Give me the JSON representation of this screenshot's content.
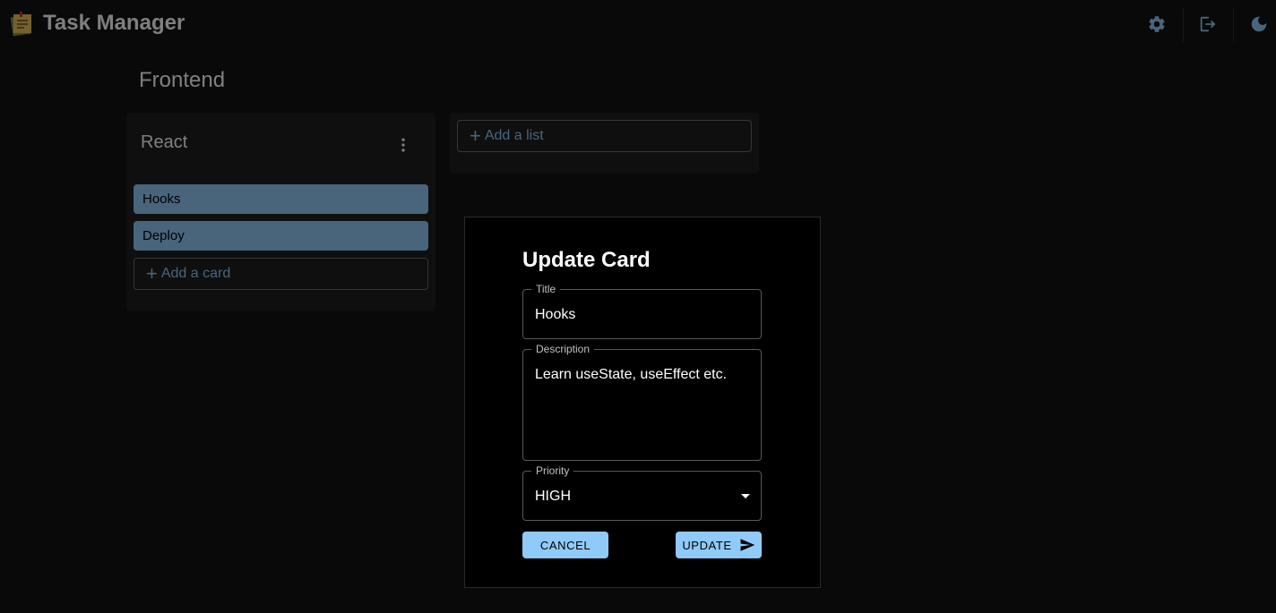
{
  "appbar": {
    "title": "Task Manager",
    "icons": [
      "settings-gear-icon",
      "logout-icon",
      "dark-mode-moon-icon"
    ]
  },
  "board": {
    "title": "Frontend",
    "lists": [
      {
        "title": "React",
        "cards": [
          {
            "title": "Hooks"
          },
          {
            "title": "Deploy"
          }
        ],
        "add_card_label": "Add a card"
      }
    ],
    "add_list_label": "Add a list"
  },
  "dialog": {
    "title": "Update Card",
    "title_field": {
      "label": "Title",
      "value": "Hooks"
    },
    "description_field": {
      "label": "Description",
      "value": "Learn useState, useEffect etc."
    },
    "priority_field": {
      "label": "Priority",
      "value": "HIGH"
    },
    "cancel_label": "CANCEL",
    "update_label": "UPDATE"
  },
  "colors": {
    "accent": "#90caf9",
    "background": "#121212",
    "surface": "#1e1e1e"
  }
}
